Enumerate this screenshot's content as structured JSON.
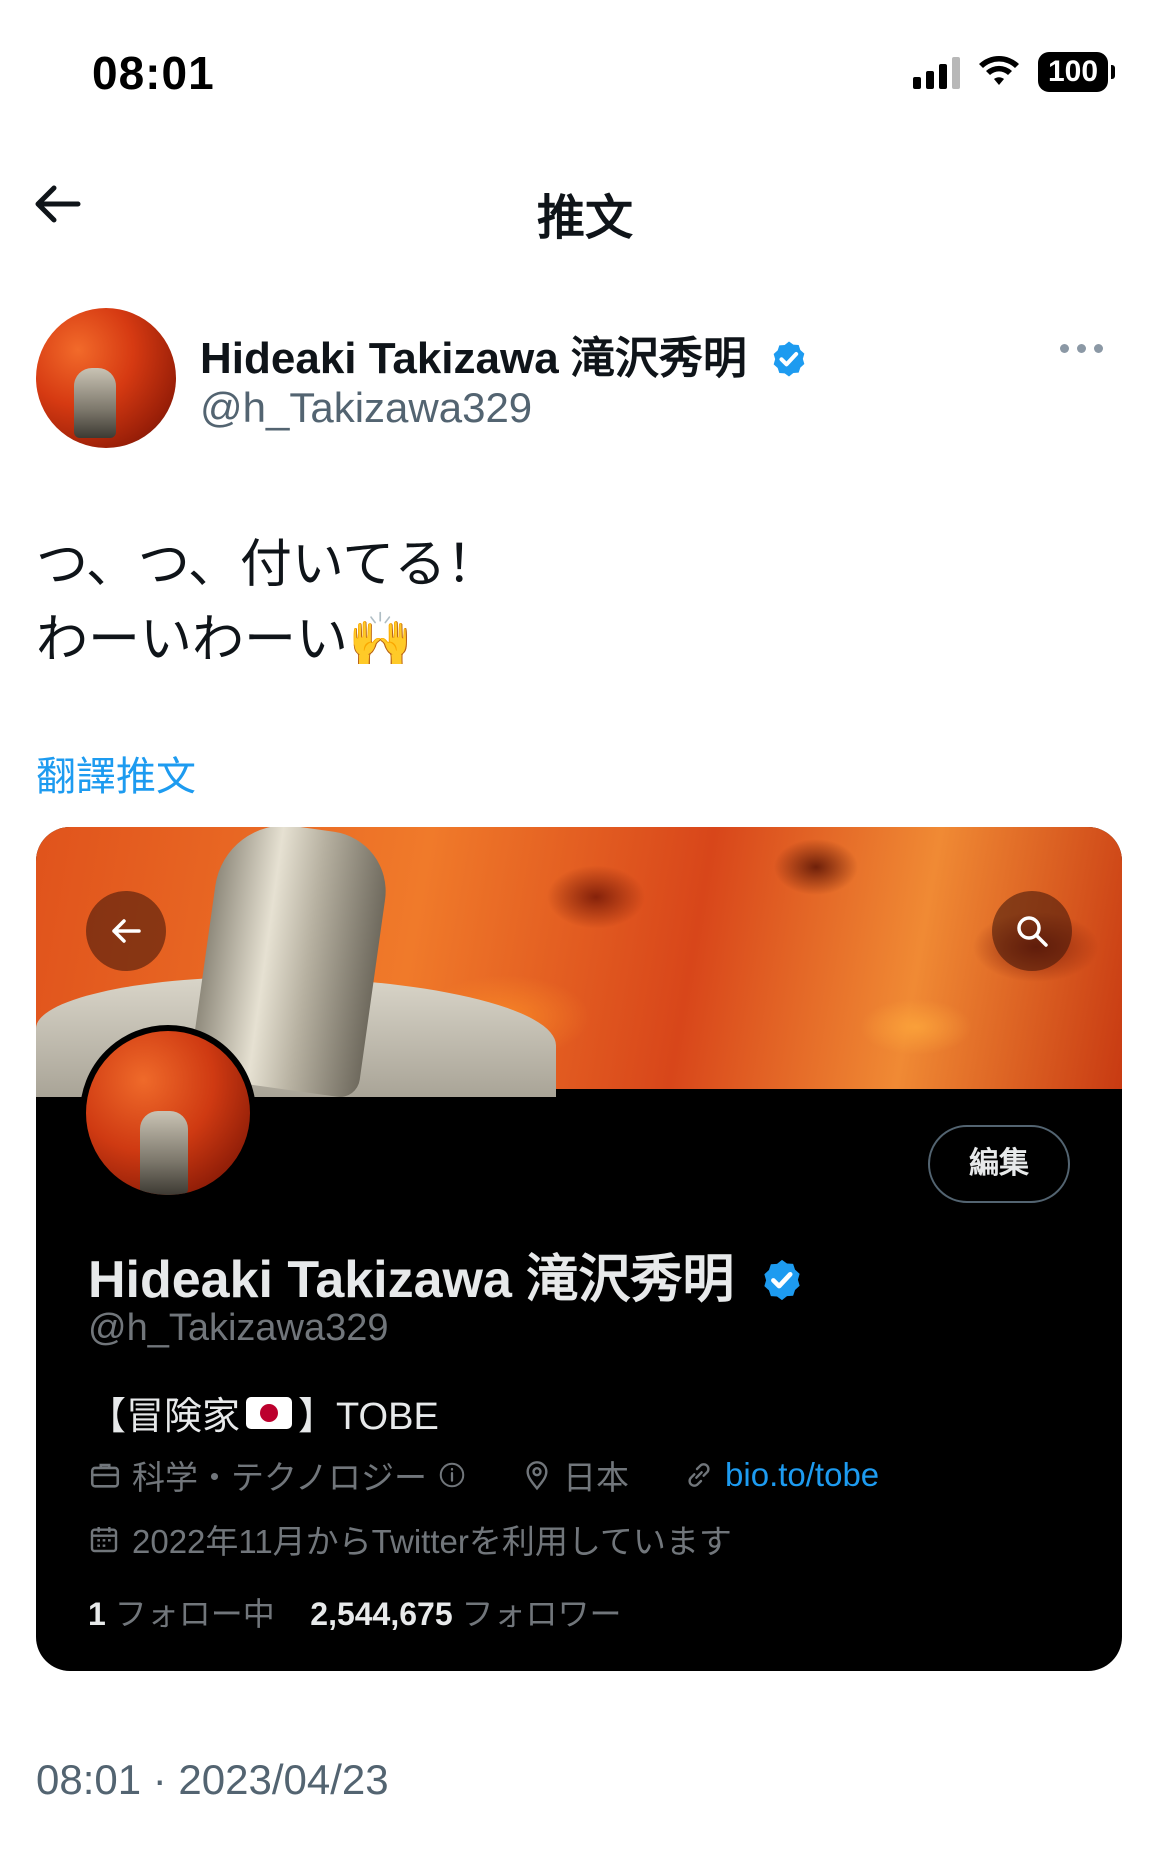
{
  "status_bar": {
    "time": "08:01",
    "battery": "100"
  },
  "nav": {
    "title": "推文"
  },
  "author": {
    "name": "Hideaki Takizawa 滝沢秀明",
    "handle": "@h_Takizawa329"
  },
  "tweet": {
    "lines": "つ、つ、付いてる！\nわーいわーい🙌",
    "translate_label": "翻譯推文",
    "timestamp": "08:01 · 2023/04/23"
  },
  "embedded_profile": {
    "edit_label": "編集",
    "name": "Hideaki Takizawa 滝沢秀明",
    "handle": "@h_Takizawa329",
    "bio_prefix": "【冒険家",
    "bio_suffix": "】TOBE",
    "category": "科学・テクノロジー",
    "location": "日本",
    "link": "bio.to/tobe",
    "joined": "2022年11月からTwitterを利用しています",
    "following_count": "1",
    "following_label": "フォロー中",
    "followers_count": "2,544,675",
    "followers_label": "フォロワー"
  },
  "colors": {
    "accent": "#1d9bf0",
    "text": "#0f1419",
    "secondary": "#536471"
  },
  "icons": [
    "back-arrow-icon",
    "verified-badge-icon",
    "more-icon",
    "search-icon",
    "briefcase-icon",
    "info-icon",
    "location-pin-icon",
    "link-icon",
    "calendar-icon",
    "flag-jp-icon"
  ]
}
